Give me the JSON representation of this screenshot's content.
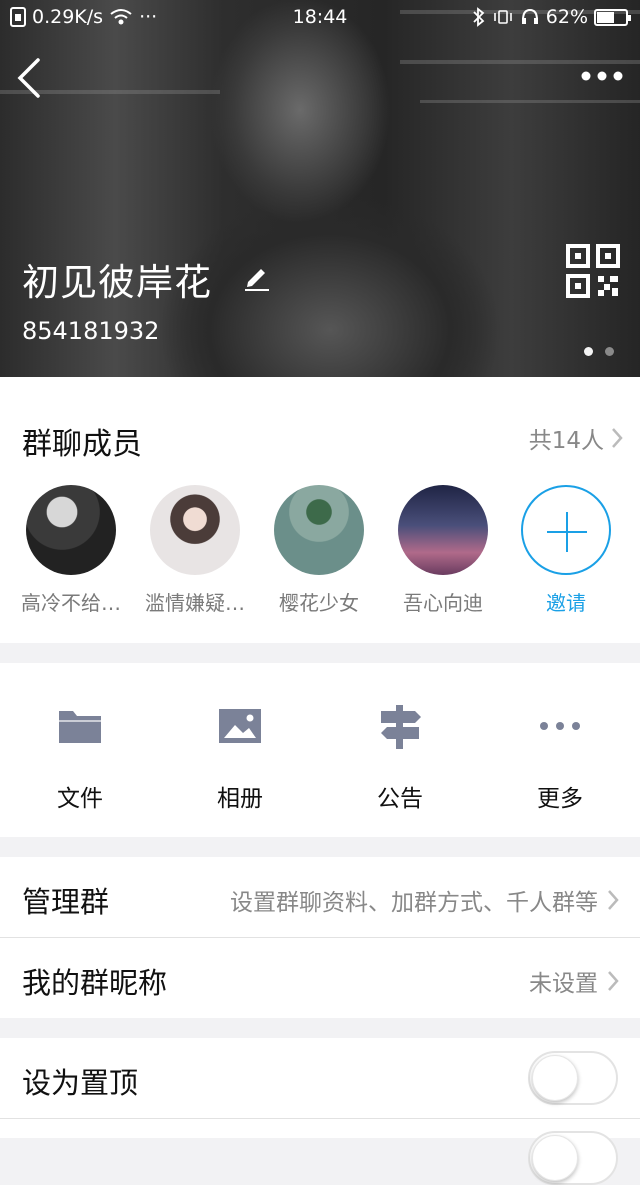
{
  "status_bar": {
    "speed": "0.29K/s",
    "time": "18:44",
    "battery": "62%",
    "battery_level": 0.62
  },
  "header": {
    "group_name": "初见彼岸花",
    "group_id": "854181932",
    "page_index": 1,
    "page_total": 2
  },
  "members": {
    "title": "群聊成员",
    "count": "共14人",
    "list": [
      {
        "name": "高冷不给…"
      },
      {
        "name": "滥情嫌疑…"
      },
      {
        "name": "樱花少女"
      },
      {
        "name": "吾心向迪"
      }
    ],
    "invite_label": "邀请"
  },
  "tools": [
    {
      "label": "文件",
      "icon": "folder-icon"
    },
    {
      "label": "相册",
      "icon": "image-icon"
    },
    {
      "label": "公告",
      "icon": "signpost-icon"
    },
    {
      "label": "更多",
      "icon": "more-icon"
    }
  ],
  "rows": {
    "manage": {
      "label": "管理群",
      "value": "设置群聊资料、加群方式、千人群等"
    },
    "nickname": {
      "label": "我的群昵称",
      "value": "未设置"
    },
    "pin": {
      "label": "设为置顶",
      "on": false
    }
  },
  "colors": {
    "accent": "#1aa0e6",
    "icon_gray": "#7b8298"
  }
}
